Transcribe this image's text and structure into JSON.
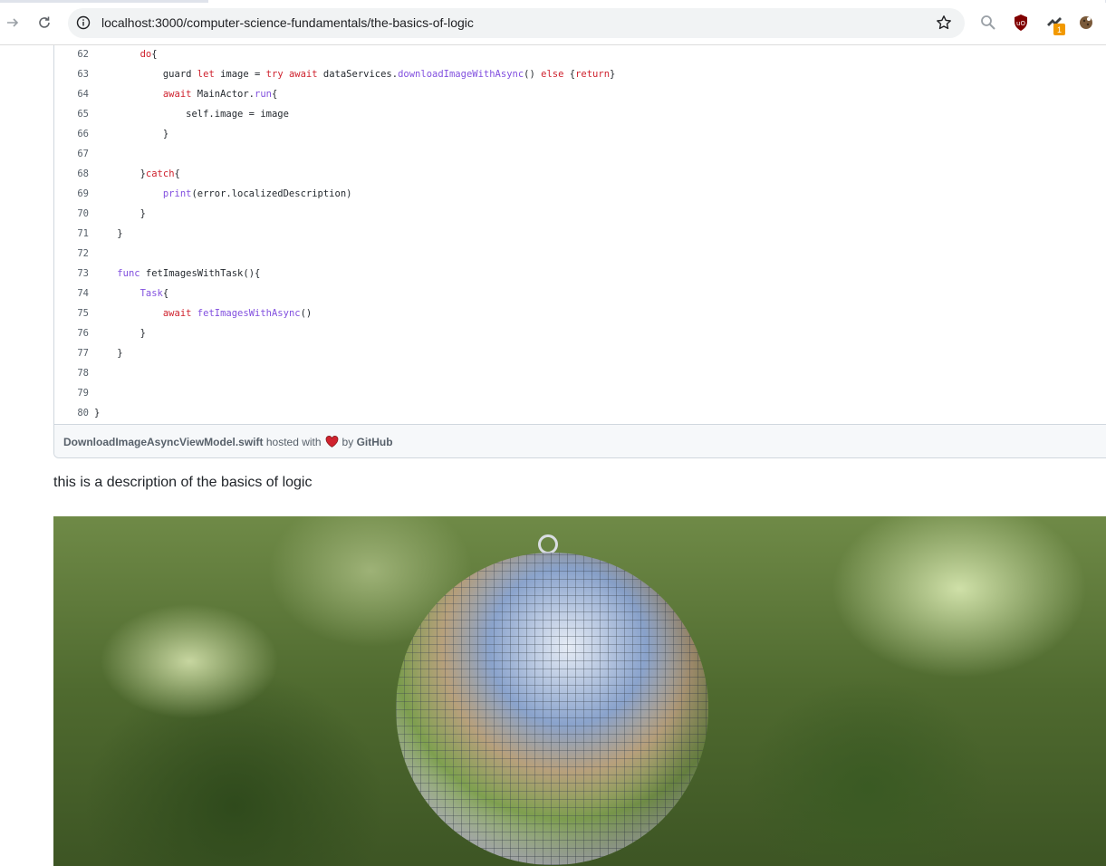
{
  "browser": {
    "url": "localhost:3000/computer-science-fundamentals/the-basics-of-logic",
    "extension_badge": "1"
  },
  "gist": {
    "lines": [
      {
        "n": "62",
        "parts": [
          [
            "",
            "        "
          ],
          [
            "kw",
            "do"
          ],
          [
            "",
            "{"
          ]
        ]
      },
      {
        "n": "63",
        "parts": [
          [
            "",
            "            guard "
          ],
          [
            "kw",
            "let"
          ],
          [
            "",
            " image = "
          ],
          [
            "kw",
            "try"
          ],
          [
            "",
            " "
          ],
          [
            "kw",
            "await"
          ],
          [
            "",
            " dataServices."
          ],
          [
            "fn",
            "downloadImageWithAsync"
          ],
          [
            "",
            "() "
          ],
          [
            "kw",
            "else"
          ],
          [
            "",
            " {"
          ],
          [
            "kw",
            "return"
          ],
          [
            "",
            "}"
          ]
        ]
      },
      {
        "n": "64",
        "parts": [
          [
            "",
            "            "
          ],
          [
            "kw",
            "await"
          ],
          [
            "",
            " MainActor."
          ],
          [
            "fn",
            "run"
          ],
          [
            "",
            "{"
          ]
        ]
      },
      {
        "n": "65",
        "parts": [
          [
            "",
            "                self.image = image"
          ]
        ]
      },
      {
        "n": "66",
        "parts": [
          [
            "",
            "            }"
          ]
        ]
      },
      {
        "n": "67",
        "parts": [
          [
            "",
            ""
          ]
        ]
      },
      {
        "n": "68",
        "parts": [
          [
            "",
            "        }"
          ],
          [
            "kw",
            "catch"
          ],
          [
            "",
            "{"
          ]
        ]
      },
      {
        "n": "69",
        "parts": [
          [
            "",
            "            "
          ],
          [
            "fn",
            "print"
          ],
          [
            "",
            "(error.localizedDescription)"
          ]
        ]
      },
      {
        "n": "70",
        "parts": [
          [
            "",
            "        }"
          ]
        ]
      },
      {
        "n": "71",
        "parts": [
          [
            "",
            "    }"
          ]
        ]
      },
      {
        "n": "72",
        "parts": [
          [
            "",
            ""
          ]
        ]
      },
      {
        "n": "73",
        "parts": [
          [
            "",
            "    "
          ],
          [
            "fn",
            "func"
          ],
          [
            "",
            " fetImagesWithTask(){"
          ]
        ]
      },
      {
        "n": "74",
        "parts": [
          [
            "",
            "        "
          ],
          [
            "fn",
            "Task"
          ],
          [
            "",
            "{"
          ]
        ]
      },
      {
        "n": "75",
        "parts": [
          [
            "",
            "            "
          ],
          [
            "kw",
            "await"
          ],
          [
            "",
            " "
          ],
          [
            "fn",
            "fetImagesWithAsync"
          ],
          [
            "",
            "()"
          ]
        ]
      },
      {
        "n": "76",
        "parts": [
          [
            "",
            "        }"
          ]
        ]
      },
      {
        "n": "77",
        "parts": [
          [
            "",
            "    }"
          ]
        ]
      },
      {
        "n": "78",
        "parts": [
          [
            "",
            ""
          ]
        ]
      },
      {
        "n": "79",
        "parts": [
          [
            "",
            ""
          ]
        ]
      },
      {
        "n": "80",
        "parts": [
          [
            "",
            "}"
          ]
        ]
      }
    ],
    "file_name": "DownloadImageAsyncViewModel.swift",
    "hosted_text": "hosted with",
    "by_text": "by",
    "host_name": "GitHub"
  },
  "description": "this is a description of the basics of logic",
  "colors": {
    "keyword": "#cf222e",
    "function": "#8250df",
    "heart": "#cf222e"
  }
}
